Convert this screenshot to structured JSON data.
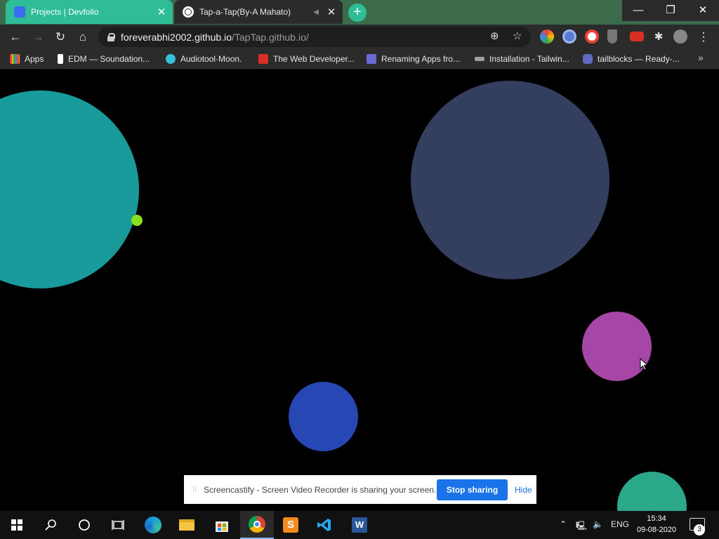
{
  "browser": {
    "tabs": [
      {
        "title": "Projects | Devfolio",
        "active": false
      },
      {
        "title": "Tap-a-Tap(By-A Mahato)",
        "active": true
      }
    ],
    "new_tab": "+",
    "address": {
      "host": "foreverabhi2002.github.io",
      "path": "/TapTap.github.io/"
    },
    "bookmarks": [
      {
        "label": "Apps",
        "color": "#e94235"
      },
      {
        "label": "EDM — Soundation...",
        "color": "#ffffff"
      },
      {
        "label": "Audiotool·Moon.",
        "color": "#36c1d6"
      },
      {
        "label": "The Web Developer...",
        "color": "#d93025"
      },
      {
        "label": "Renaming Apps fro...",
        "color": "#6b6bd6"
      },
      {
        "label": "Installation - Tailwin...",
        "color": "#9aa0a6"
      },
      {
        "label": "tailblocks — Ready-...",
        "color": "#5c6bc0"
      }
    ],
    "bookmarks_more": "»"
  },
  "game": {
    "background": "#000000",
    "circles": [
      {
        "name": "teal-circle",
        "color": "#1a9b9b"
      },
      {
        "name": "slate-circle",
        "color": "#343e5e"
      },
      {
        "name": "magenta-circle",
        "color": "#a646a6"
      },
      {
        "name": "blue-circle",
        "color": "#2748b4"
      },
      {
        "name": "green-circle",
        "color": "#2ba888"
      },
      {
        "name": "lime-dot",
        "color": "#8be01c"
      }
    ]
  },
  "screencastify": {
    "message": "Screencastify - Screen Video Recorder is sharing your screen.",
    "stop_label": "Stop sharing",
    "hide_label": "Hide"
  },
  "taskbar": {
    "language": "ENG",
    "time": "15:34",
    "date": "09-08-2020",
    "notifications": "3"
  }
}
